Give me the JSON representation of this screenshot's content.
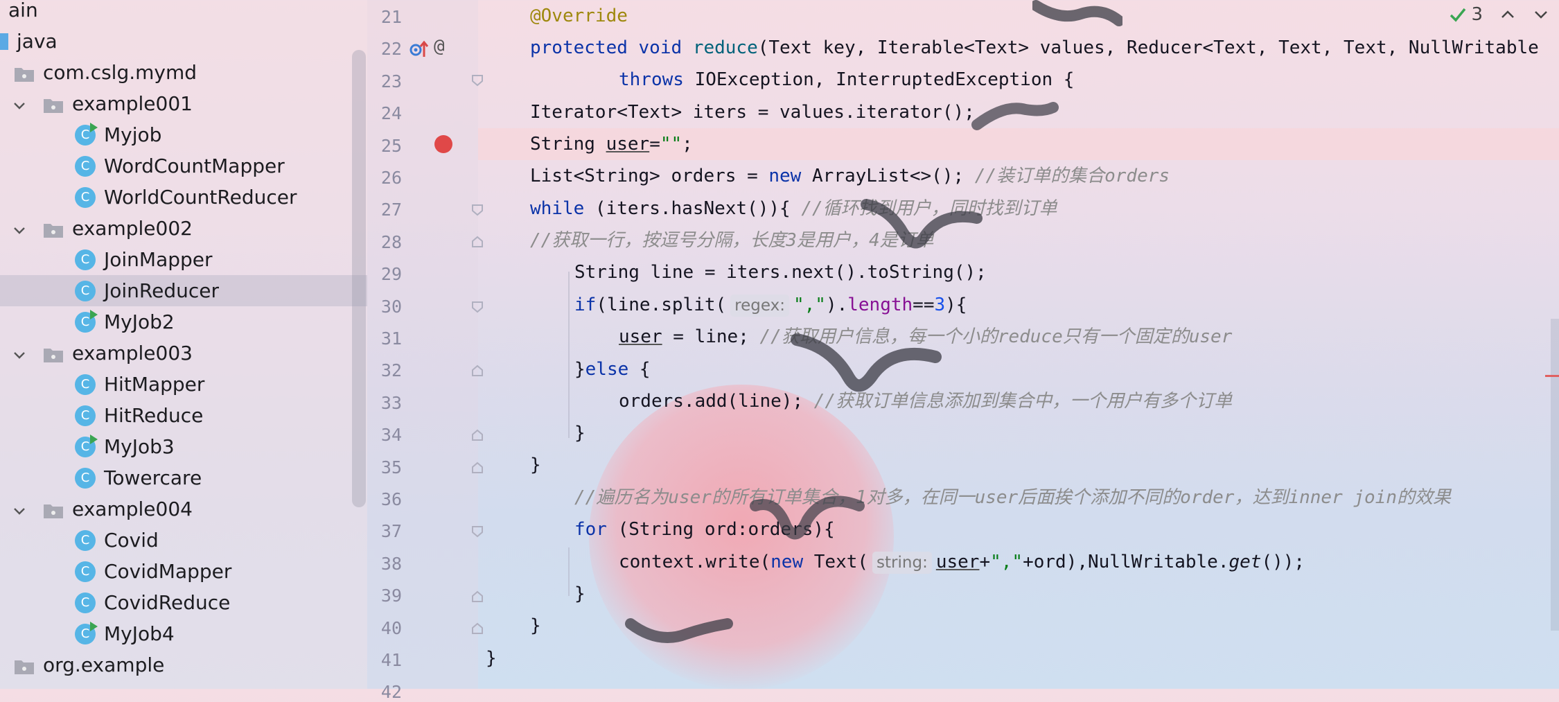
{
  "sidebar": {
    "items": [
      {
        "label": "ain",
        "type": "folder-partial",
        "indent": 0
      },
      {
        "label": "java",
        "type": "src",
        "indent": 0
      },
      {
        "label": "com.cslg.mymd",
        "type": "package",
        "indent": 1
      },
      {
        "label": "example001",
        "type": "package",
        "indent": 2
      },
      {
        "label": "Myjob",
        "type": "class-run",
        "indent": 3
      },
      {
        "label": "WordCountMapper",
        "type": "class",
        "indent": 3
      },
      {
        "label": "WorldCountReducer",
        "type": "class",
        "indent": 3
      },
      {
        "label": "example002",
        "type": "package",
        "indent": 2
      },
      {
        "label": "JoinMapper",
        "type": "class",
        "indent": 3
      },
      {
        "label": "JoinReducer",
        "type": "class",
        "indent": 3
      },
      {
        "label": "MyJob2",
        "type": "class-run",
        "indent": 3
      },
      {
        "label": "example003",
        "type": "package",
        "indent": 2
      },
      {
        "label": "HitMapper",
        "type": "class",
        "indent": 3
      },
      {
        "label": "HitReduce",
        "type": "class",
        "indent": 3
      },
      {
        "label": "MyJob3",
        "type": "class-run",
        "indent": 3
      },
      {
        "label": "Towercare",
        "type": "class",
        "indent": 3
      },
      {
        "label": "example004",
        "type": "package",
        "indent": 2
      },
      {
        "label": "Covid",
        "type": "class",
        "indent": 3
      },
      {
        "label": "CovidMapper",
        "type": "class",
        "indent": 3
      },
      {
        "label": "CovidReduce",
        "type": "class",
        "indent": 3
      },
      {
        "label": "MyJob4",
        "type": "class-run",
        "indent": 3
      },
      {
        "label": "org.example",
        "type": "package",
        "indent": 1
      }
    ],
    "class_icon_letter": "C"
  },
  "editor": {
    "inspection_count": "3",
    "line_numbers": [
      "21",
      "22",
      "23",
      "24",
      "25",
      "26",
      "27",
      "28",
      "29",
      "30",
      "31",
      "32",
      "33",
      "34",
      "35",
      "36",
      "37",
      "38",
      "39",
      "40",
      "41",
      "42"
    ],
    "hints": {
      "regex": "regex:",
      "string": "string:"
    },
    "code": {
      "l21": {
        "anno": "@Override"
      },
      "l22": {
        "kw": "protected void ",
        "fn": "reduce",
        "rest": "(Text key, Iterable<Text> values, Reducer<Text, Text, Text, NullWritable"
      },
      "l23": {
        "kw": "throws ",
        "rest": "IOException, InterruptedException {"
      },
      "l24": {
        "text": "Iterator<Text> iters = values.iterator();"
      },
      "l25": {
        "a": "String ",
        "user": "user",
        "eq": "=",
        "str": "\"\"",
        "end": ";"
      },
      "l26": {
        "a": "List<String> orders = ",
        "kw": "new",
        "b": " ArrayList<>(); ",
        "cmt": "//装订单的集合orders"
      },
      "l27": {
        "kw": "while",
        "a": " (iters.hasNext()){ ",
        "cmt": "//循环找到用户，同时找到订单"
      },
      "l28": {
        "cmt": "//获取一行，按逗号分隔，长度3是用户，4是订单"
      },
      "l29": {
        "text": "String line = iters.next().toString();"
      },
      "l30": {
        "kw": "if",
        "a": "(line.split(",
        "str": "\",\"",
        "b": ").",
        "field": "length",
        "c": "==",
        "num": "3",
        "d": "){"
      },
      "l31": {
        "user": "user",
        "a": " = line; ",
        "cmt": "//获取用户信息，每一个小的reduce只有一个固定的user"
      },
      "l32": {
        "a": "}",
        "kw": "else",
        "b": " {"
      },
      "l33": {
        "a": "orders.add(line); ",
        "cmt": "//获取订单信息添加到集合中，一个用户有多个订单"
      },
      "l34": {
        "text": "}"
      },
      "l35": {
        "text": "}"
      },
      "l36": {
        "cmt": "//遍历名为user的所有订单集合，1对多，在同一user后面挨个添加不同的order，达到inner join的效果"
      },
      "l37": {
        "kw": "for",
        "a": " (String ord:orders){"
      },
      "l38": {
        "a": "context.write(",
        "kw": "new",
        "b": " Text(",
        "user": "user",
        "c": "+",
        "str": "\",\"",
        "d": "+ord),NullWritable.",
        "ital": "get",
        "e": "());"
      },
      "l39": {
        "text": "}"
      },
      "l40": {
        "text": "}"
      },
      "l41": {
        "text": "}"
      }
    }
  }
}
